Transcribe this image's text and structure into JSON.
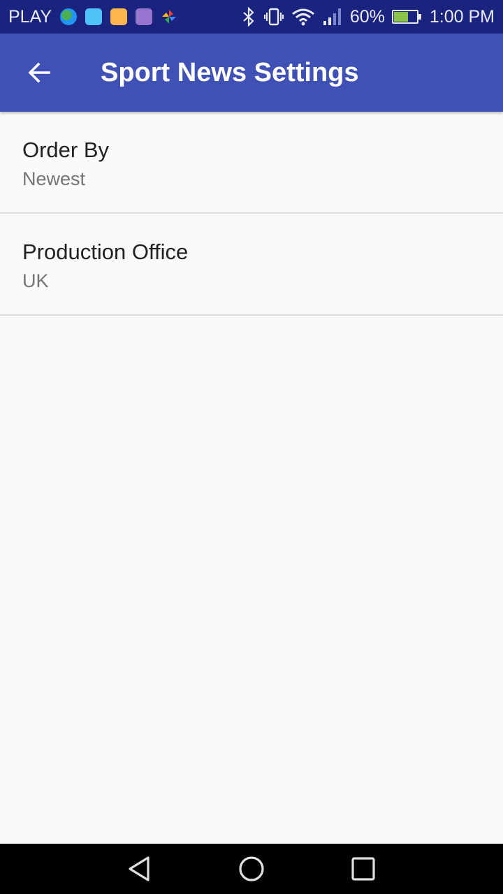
{
  "status_bar": {
    "carrier": "PLAY",
    "battery_percent": "60%",
    "time": "1:00 PM",
    "battery_level": 0.6,
    "notification_icons": [
      "globe-icon",
      "android-icon",
      "store-icon",
      "gallery-icon",
      "pinwheel-icon"
    ],
    "system_icons": [
      "bluetooth-icon",
      "vibrate-icon",
      "wifi-icon",
      "signal-icon",
      "battery-charging-icon"
    ]
  },
  "app_bar": {
    "title": "Sport News Settings",
    "back_icon": "arrow-back-icon",
    "background": "#3f51b5"
  },
  "preferences": [
    {
      "title": "Order By",
      "summary": "Newest"
    },
    {
      "title": "Production Office",
      "summary": "UK"
    }
  ],
  "nav_bar": {
    "buttons": [
      "back-triangle-icon",
      "home-circle-icon",
      "recents-square-icon"
    ]
  },
  "colors": {
    "status_bar": "#1a237e",
    "background": "#fafafa",
    "title_text": "#212121",
    "summary_text": "#757575"
  }
}
